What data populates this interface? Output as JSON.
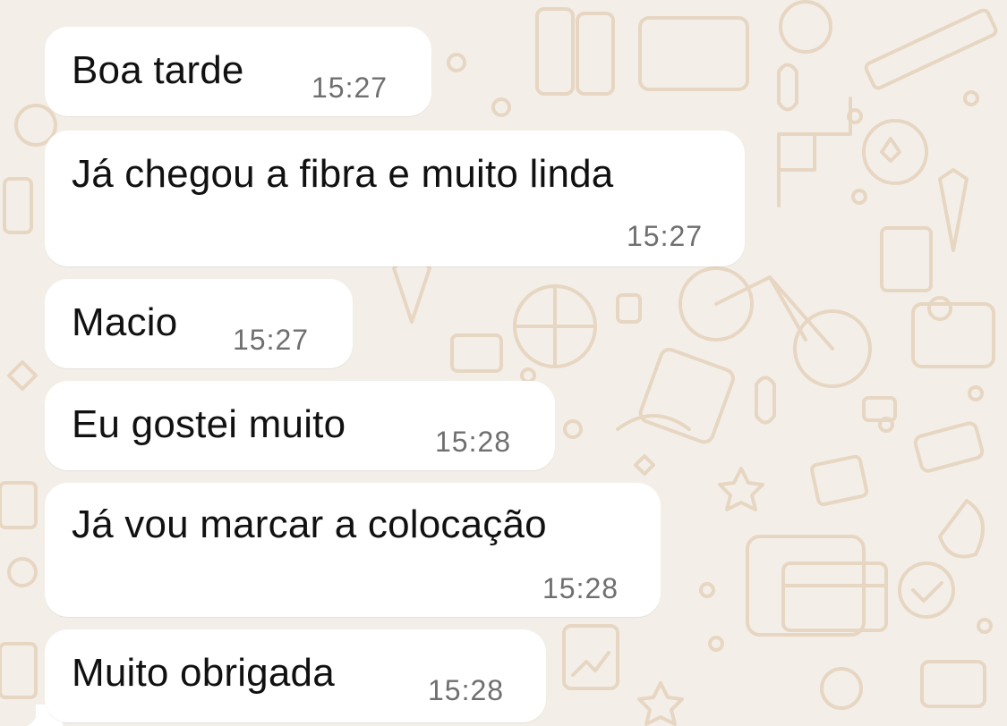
{
  "conversation": {
    "messages": [
      {
        "text": "Boa tarde",
        "time": "15:27"
      },
      {
        "text": "Já chegou a fibra e muito linda",
        "time": "15:27"
      },
      {
        "text": "Macio",
        "time": "15:27"
      },
      {
        "text": "Eu gostei muito",
        "time": "15:28"
      },
      {
        "text": "Já vou marcar a colocação",
        "time": "15:28"
      },
      {
        "text": "Muito obrigada",
        "time": "15:28"
      }
    ]
  },
  "colors": {
    "wallpaper": "#f3efe8",
    "doodle": "#e9d9c6",
    "bubble": "#ffffff",
    "text": "#111111",
    "timestamp": "#6f6f6f"
  }
}
